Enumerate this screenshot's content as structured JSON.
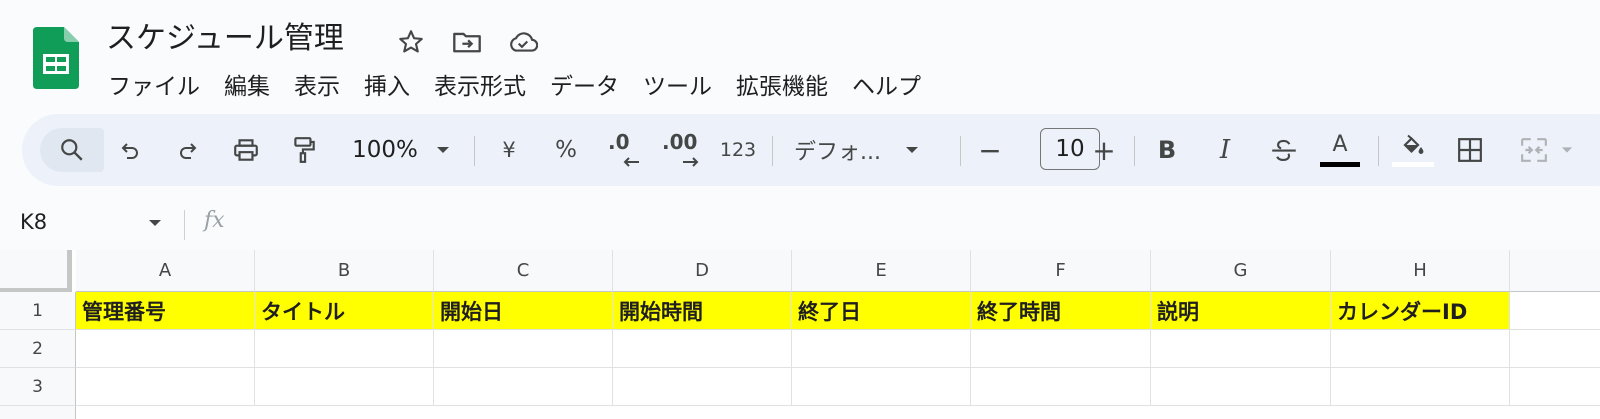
{
  "doc": {
    "title": "スケジュール管理",
    "icons": [
      "star-icon",
      "move-to-folder-icon",
      "cloud-saved-icon"
    ]
  },
  "menu": [
    "ファイル",
    "編集",
    "表示",
    "挿入",
    "表示形式",
    "データ",
    "ツール",
    "拡張機能",
    "ヘルプ"
  ],
  "toolbar": {
    "zoom": "100%",
    "currency": "¥",
    "percent": "%",
    "decrease_decimal": ".0",
    "increase_decimal": ".00",
    "number_format": "123",
    "font": "デフォ...",
    "font_size_minus": "−",
    "font_size": "10",
    "font_size_plus": "+",
    "bold": "B",
    "italic": "I",
    "text_color_letter": "A",
    "text_color": "#000000",
    "fill_color": "#ffffff"
  },
  "formula_bar": {
    "cell_ref": "K8",
    "fx": "fx"
  },
  "grid": {
    "columns": [
      "A",
      "B",
      "C",
      "D",
      "E",
      "F",
      "G",
      "H"
    ],
    "rows": [
      "1",
      "2",
      "3"
    ],
    "header_fill": "#ffff00",
    "row1": [
      "管理番号",
      "タイトル",
      "開始日",
      "開始時間",
      "終了日",
      "終了時間",
      "説明",
      "カレンダーID"
    ]
  }
}
